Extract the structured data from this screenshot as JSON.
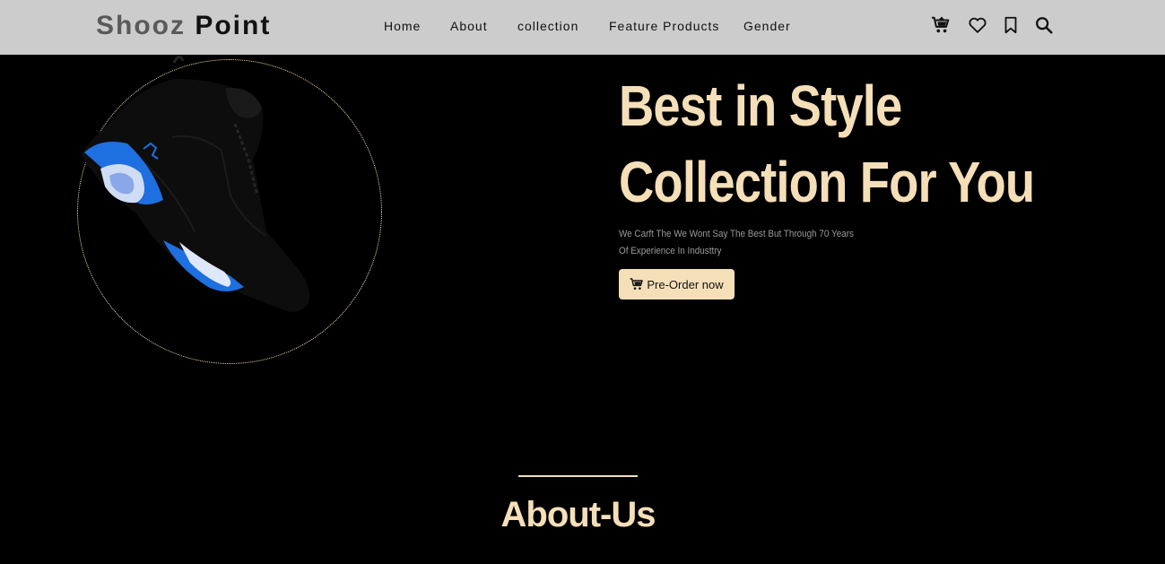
{
  "brand": {
    "part1": "Shooz",
    "part2": "Point"
  },
  "nav": {
    "links": [
      "Home",
      "About",
      "collection",
      "Feature Products",
      "Gender"
    ],
    "icons": [
      "cart-icon",
      "heart-icon",
      "bookmark-icon",
      "search-icon"
    ]
  },
  "hero": {
    "title_line1": "Best in Style",
    "title_line2": "Collection For You",
    "description": "We Carft The We Wont Say The Best But Through 70 Years Of Experience In Industtry",
    "button_label": "Pre-Order now",
    "image": "sneaker"
  },
  "about": {
    "title": "About-Us"
  },
  "colors": {
    "accent": "#f5dfb8",
    "navbar": "#cccccc",
    "background": "#000000",
    "shoe_accent": "#1e6fe0"
  }
}
